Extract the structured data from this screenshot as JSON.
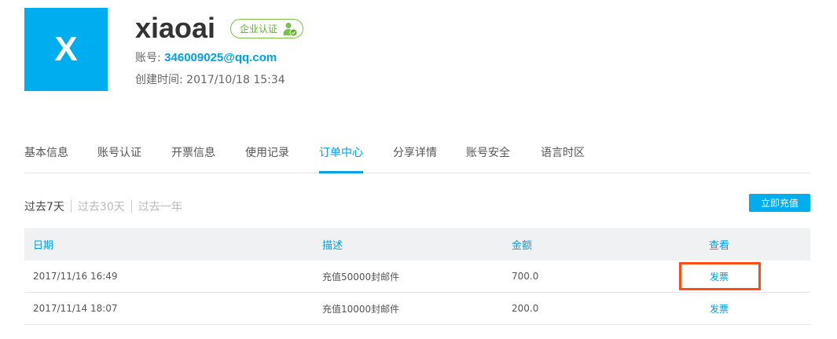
{
  "profile": {
    "avatar_letter": "X",
    "username": "xiaoai",
    "badge_label": "企业认证",
    "account_label": "账号: ",
    "account_email": "346009025@qq.com",
    "created_label": "创建时间: ",
    "created_value": "2017/10/18 15:34"
  },
  "tabs": [
    {
      "label": "基本信息"
    },
    {
      "label": "账号认证"
    },
    {
      "label": "开票信息"
    },
    {
      "label": "使用记录"
    },
    {
      "label": "订单中心",
      "active": true
    },
    {
      "label": "分享详情"
    },
    {
      "label": "账号安全"
    },
    {
      "label": "语言时区"
    }
  ],
  "filters": [
    {
      "label": "过去7天",
      "active": true
    },
    {
      "label": "过去30天"
    },
    {
      "label": "过去一年"
    }
  ],
  "recharge_label": "立即充值",
  "table": {
    "headers": [
      "日期",
      "描述",
      "金额",
      "查看"
    ],
    "rows": [
      {
        "date": "2017/11/16 16:49",
        "desc": "充值50000封邮件",
        "amount": "700.0",
        "view": "发票",
        "highlighted": true
      },
      {
        "date": "2017/11/14 18:07",
        "desc": "充值10000封邮件",
        "amount": "200.0",
        "view": "发票"
      }
    ]
  },
  "colors": {
    "accent": "#00a0e9",
    "avatar": "#00aeef",
    "badge_green": "#5cae28",
    "highlight": "#ff4b14"
  }
}
